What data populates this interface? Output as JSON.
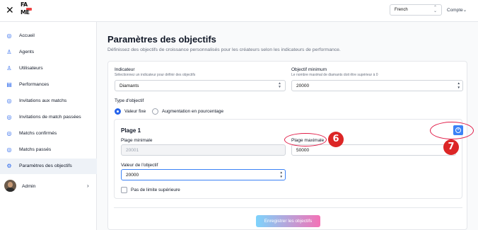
{
  "topbar": {
    "close_icon": "close-icon",
    "logo_line1": "FA",
    "logo_line2": "ME",
    "language": "French",
    "account": "Compte"
  },
  "sidebar": {
    "items": [
      {
        "label": "Accueil",
        "icon": "home-icon"
      },
      {
        "label": "Agents",
        "icon": "user-icon"
      },
      {
        "label": "Utilisateurs",
        "icon": "user-icon"
      },
      {
        "label": "Performances",
        "icon": "chart-icon"
      },
      {
        "label": "Invitations aux matchs",
        "icon": "invite-icon"
      },
      {
        "label": "Invitations de match passées",
        "icon": "invite-icon"
      },
      {
        "label": "Matchs confirmés",
        "icon": "check-icon"
      },
      {
        "label": "Matchs passés",
        "icon": "check-icon"
      },
      {
        "label": "Paramètres des objectifs",
        "icon": "gear-icon"
      }
    ],
    "active_index": 8,
    "admin": {
      "label": "Admin"
    }
  },
  "main": {
    "title": "Paramètres des objectifs",
    "subtitle": "Définissez des objectifs de croissance personnalisés pour les créateurs selon les indicateurs de performance.",
    "indicator": {
      "label": "Indicateur",
      "help": "Sélectionnez un indicateur pour définir des objectifs",
      "value": "Diamants"
    },
    "min_goal": {
      "label": "Objectif minimum",
      "help": "Le nombre maximal de diamants doit être supérieur à 0",
      "value": "20000"
    },
    "goal_type": {
      "label": "Type d'objectif",
      "options": [
        "Valeur fixe",
        "Augmentation en pourcentage"
      ],
      "selected_index": 0
    },
    "range": {
      "title": "Plage 1",
      "min_label": "Plage minimale",
      "min_value": "20001",
      "max_label": "Plage maximale",
      "max_value": "50000",
      "goal_label": "Valeur de l'objectif",
      "goal_value": "20000",
      "no_limit_label": "Pas de limite supérieure"
    },
    "save_label": "Enregistrer les objectifs"
  },
  "annotations": {
    "badge_6": "6",
    "badge_7": "7",
    "color": "#dc2626"
  }
}
